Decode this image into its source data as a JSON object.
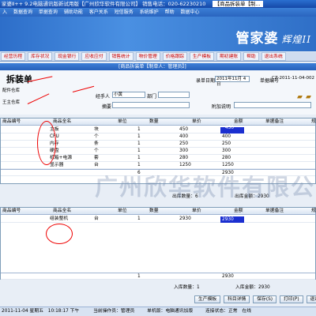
{
  "titlebar": {
    "text": "家婆Ⅱ++ 9.2电脑通讯版新试用版【广州欣华软件有限公司】",
    "phone": "销售电话：020-62230210",
    "tab": "【商品拆装单【制..."
  },
  "menubar": [
    "入",
    "数据查询",
    "单据查询",
    "辅助功能",
    "客户关系",
    "短信服务",
    "系统维护",
    "帮助",
    "数据中心"
  ],
  "logo": {
    "main": "管家婆",
    "sub": "辉煌II"
  },
  "nav": [
    "经营历程",
    "库存状况",
    "现金银行",
    "应收应付",
    "销售统计",
    "物价管理",
    "价格跟踪",
    "生产模板",
    "期初建账",
    "帮助",
    "退出系统"
  ],
  "window_title": "[商品拆装单【制单人：管理员】]",
  "form": {
    "doc_title": "拆装单",
    "date_label": "录单日期",
    "date_value": "2011年11月 4日",
    "docno_label": "单据编号",
    "docno_value": "CZ-2011-11-04-002",
    "out_wh": "配件仓库",
    "in_wh": "王主仓库",
    "handler_label": "经手人",
    "handler_value": "小黄",
    "dept_label": "部门",
    "dept_value": "",
    "summary_label": "摘要",
    "summary_value": "",
    "note_label": "附加说明",
    "note_value": ""
  },
  "out_table": {
    "headers": [
      "商品编号",
      "商品全名",
      "单位",
      "数量",
      "单价",
      "金额",
      "单据备注",
      "规"
    ],
    "rows": [
      {
        "name": "主板",
        "unit": "块",
        "qty": "1",
        "price": "450",
        "amount": "450",
        "selected": false
      },
      {
        "name": "CPU",
        "unit": "个",
        "qty": "1",
        "price": "400",
        "amount": "400",
        "selected": false
      },
      {
        "name": "内存",
        "unit": "条",
        "qty": "1",
        "price": "250",
        "amount": "250",
        "selected": false
      },
      {
        "name": "硬盘",
        "unit": "个",
        "qty": "1",
        "price": "300",
        "amount": "300",
        "selected": false
      },
      {
        "name": "机箱+电源",
        "unit": "套",
        "qty": "1",
        "price": "280",
        "amount": "280",
        "selected": false
      },
      {
        "name": "显示器",
        "unit": "台",
        "qty": "1",
        "price": "1250",
        "amount": "1250",
        "selected": false
      },
      {
        "name": "",
        "unit": "",
        "qty": "6",
        "price": "",
        "amount": "2930",
        "selected": false
      }
    ],
    "summary_qty": "出库数量：6",
    "summary_amount": "出库金额：2930"
  },
  "in_table": {
    "headers": [
      "商品编号",
      "商品全名",
      "单位",
      "数量",
      "单价",
      "金额",
      "单据备注",
      "规"
    ],
    "rows": [
      {
        "name": "组装整机",
        "unit": "台",
        "qty": "1",
        "price": "2930",
        "amount": "2930",
        "selected": true
      },
      {
        "name": "",
        "unit": "",
        "qty": "1",
        "price": "",
        "amount": "2930",
        "selected": false
      }
    ],
    "summary_qty": "入库数量：1",
    "summary_amount": "入库金额：2930"
  },
  "watermark": "广州欣华软件有限公司",
  "buttons": [
    "生产模板",
    "科目详情",
    "保存(S)",
    "打印(P)",
    "退出"
  ],
  "status": {
    "date": "2011-11-04 星期五",
    "time": "10:18:17 下午",
    "operator": "当前操作员：管理员",
    "mode": "单机版：电脑通讯加版",
    "net": "连接状态：正常",
    "online": "在线"
  }
}
